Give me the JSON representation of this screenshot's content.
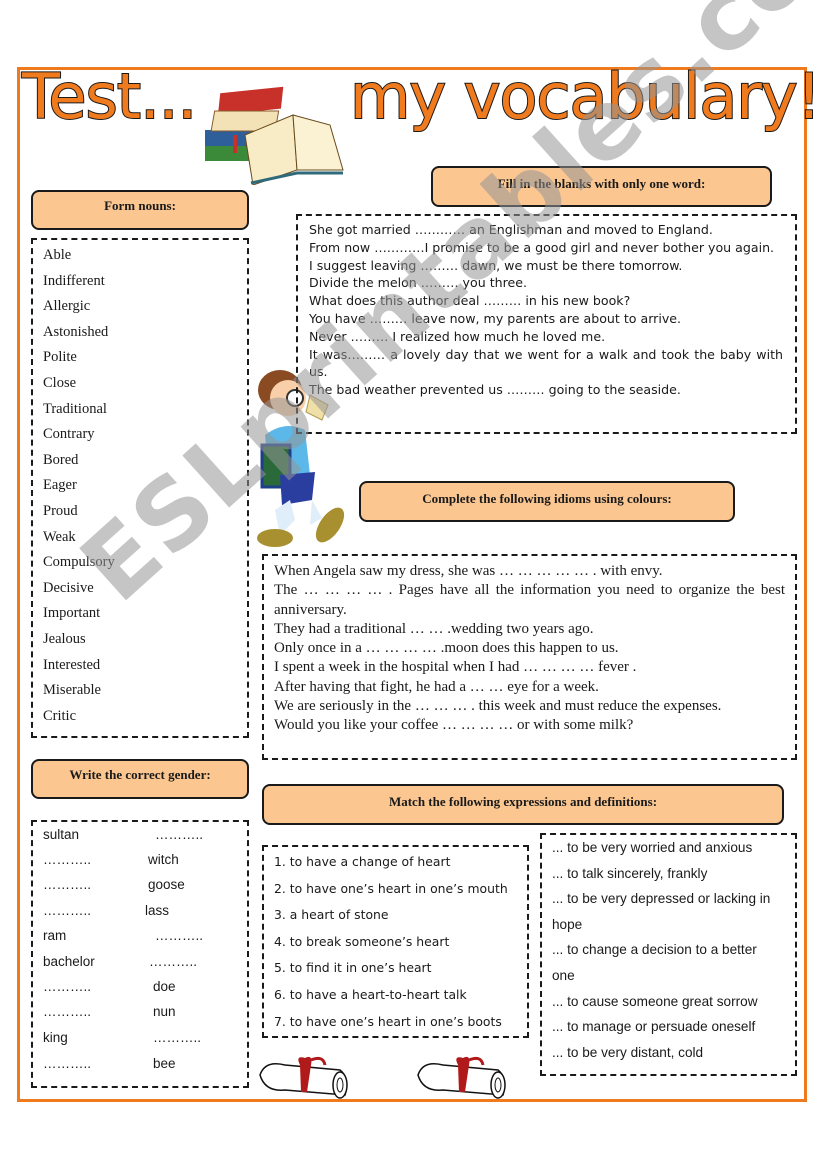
{
  "title": {
    "left": "Test...",
    "right": "my vocabulary!"
  },
  "watermark": "ESLprintables.com",
  "colors": {
    "accent_orange": "#f07a1e",
    "header_fill": "#fbc690",
    "border_dark": "#1a1a1a"
  },
  "sections": {
    "form_nouns": {
      "heading": "Form nouns:",
      "items": [
        "Able",
        "Indifferent",
        "Allergic",
        "Astonished",
        "Polite",
        "Close",
        "Traditional",
        "Contrary",
        "Bored",
        "Eager",
        "Proud",
        "Weak",
        "Compulsory",
        "Decisive",
        "Important",
        "Jealous",
        "Interested",
        "Miserable",
        "Critic"
      ]
    },
    "fill_blanks": {
      "heading": "Fill in the blanks with only one word:",
      "sentences": [
        "She got married ………… an Englishman and moved to England.",
        "From now …………I promise to be a good girl and never bother you again.",
        "I suggest leaving ……… dawn, we must be there tomorrow.",
        "Divide the melon ……… you three.",
        "What does this author deal ……… in his new book?",
        "You have ……… leave now, my parents are about to arrive.",
        "Never ……… I realized how much he loved me.",
        "It was……… a lovely day that we went for a walk and took the baby with us.",
        "The bad weather prevented us ……… going to the seaside."
      ]
    },
    "idioms_colours": {
      "heading": "Complete the following idioms using colours:",
      "sentences": [
        "When Angela saw my dress, she was … … … … … . with envy.",
        "The … … … … . Pages have all the information you need to organize the best anniversary.",
        "They had a traditional … … .wedding two years ago.",
        "Only once in a … … … … .moon does this happen to us.",
        "I spent a week in the hospital when I had … … … … fever .",
        "After having that fight, he had a … … eye for a week.",
        "We are seriously in the … … … . this week and must reduce the expenses.",
        "Would you like your coffee … … … … or with some milk?"
      ]
    },
    "gender": {
      "heading": "Write the correct gender:",
      "rows": [
        {
          "left": "sultan",
          "right": "………..",
          "right_offset": "a"
        },
        {
          "left": "………..",
          "right": "witch",
          "right_offset": "b"
        },
        {
          "left": "………..",
          "right": "goose",
          "right_offset": "b"
        },
        {
          "left": "………..",
          "right": "lass",
          "right_offset": "c"
        },
        {
          "left": "ram",
          "right": "………..",
          "right_offset": "a"
        },
        {
          "left": "bachelor",
          "right": "………..",
          "right_offset": "c"
        },
        {
          "left": "………..",
          "right": "doe",
          "right_offset": "b"
        },
        {
          "left": "………..",
          "right": "nun",
          "right_offset": "b"
        },
        {
          "left": "king",
          "right": "………..",
          "right_offset": "b"
        },
        {
          "left": "………..",
          "right": "bee",
          "right_offset": "b"
        }
      ]
    },
    "match": {
      "heading": "Match the following expressions and definitions:",
      "expressions": [
        "1. to have a change of heart",
        "2. to have one’s heart in one’s mouth",
        "3. a heart of stone",
        "4. to break someone’s heart",
        "5. to find it in one’s heart",
        "6. to have a heart-to-heart talk",
        "7. to have one’s heart in one’s boots"
      ],
      "definitions": [
        "... to be very worried and anxious",
        "... to talk sincerely, frankly",
        "... to be very depressed or lacking in hope",
        "... to change a decision to a better one",
        "... to cause someone great sorrow",
        "... to manage or persuade oneself",
        "... to be very distant, cold"
      ]
    }
  }
}
